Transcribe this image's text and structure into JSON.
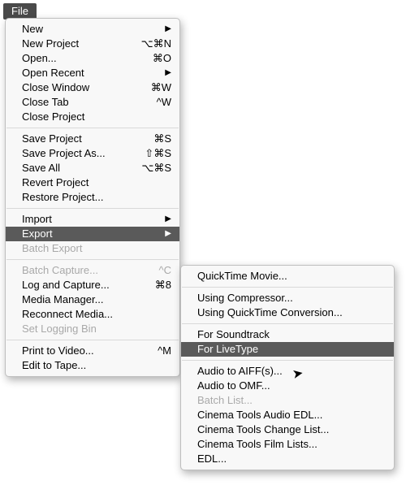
{
  "menu_title": "File",
  "file_menu": {
    "new": "New",
    "new_project": "New Project",
    "new_project_sc": "⌥⌘N",
    "open": "Open...",
    "open_sc": "⌘O",
    "open_recent": "Open Recent",
    "close_window": "Close Window",
    "close_window_sc": "⌘W",
    "close_tab": "Close Tab",
    "close_tab_sc": "^W",
    "close_project": "Close Project",
    "save_project": "Save Project",
    "save_project_sc": "⌘S",
    "save_project_as": "Save Project As...",
    "save_project_as_sc": "⇧⌘S",
    "save_all": "Save All",
    "save_all_sc": "⌥⌘S",
    "revert_project": "Revert Project",
    "restore_project": "Restore Project...",
    "import": "Import",
    "export": "Export",
    "batch_export": "Batch Export",
    "batch_capture": "Batch Capture...",
    "batch_capture_sc": "^C",
    "log_and_capture": "Log and Capture...",
    "log_and_capture_sc": "⌘8",
    "media_manager": "Media Manager...",
    "reconnect_media": "Reconnect Media...",
    "set_logging_bin": "Set Logging Bin",
    "print_to_video": "Print to Video...",
    "print_to_video_sc": "^M",
    "edit_to_tape": "Edit to Tape..."
  },
  "export_menu": {
    "quicktime_movie": "QuickTime Movie...",
    "using_compressor": "Using Compressor...",
    "using_qt_conversion": "Using QuickTime Conversion...",
    "for_soundtrack": "For Soundtrack",
    "for_livetype": "For LiveType",
    "audio_to_aiff": "Audio to AIFF(s)...",
    "audio_to_omf": "Audio to OMF...",
    "batch_list": "Batch List...",
    "cinema_audio_edl": "Cinema Tools Audio EDL...",
    "cinema_change_list": "Cinema Tools Change List...",
    "cinema_film_lists": "Cinema Tools Film Lists...",
    "edl": "EDL..."
  },
  "glyphs": {
    "submenu_arrow": "▶"
  }
}
